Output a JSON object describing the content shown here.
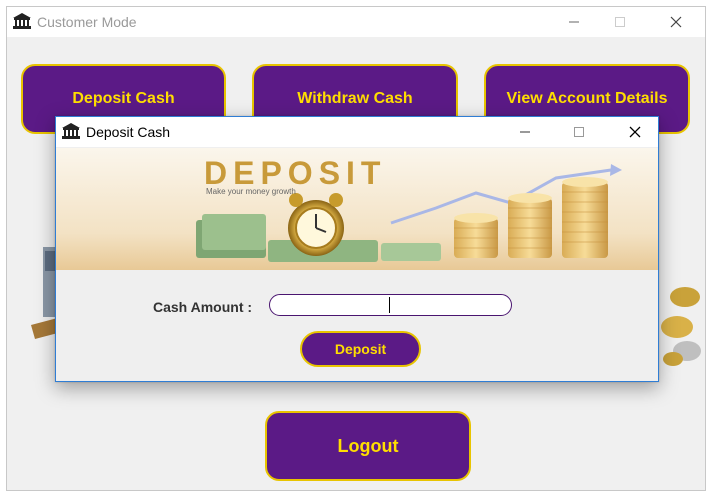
{
  "main_window": {
    "title": "Customer Mode",
    "icon": "bank-icon",
    "buttons": {
      "deposit": "Deposit Cash",
      "withdraw": "Withdraw Cash",
      "view_details": "View Account Details",
      "logout": "Logout"
    }
  },
  "dialog": {
    "title": "Deposit Cash",
    "icon": "bank-icon",
    "banner": {
      "heading": "DEPOSIT",
      "tagline": "Make your money growth"
    },
    "cash_amount_label": "Cash Amount :",
    "cash_amount_value": "",
    "deposit_button": "Deposit"
  },
  "colors": {
    "button_bg": "#5b1a86",
    "button_text": "#ffde00",
    "button_border": "#e8c400",
    "dialog_border": "#2f7dd4"
  }
}
